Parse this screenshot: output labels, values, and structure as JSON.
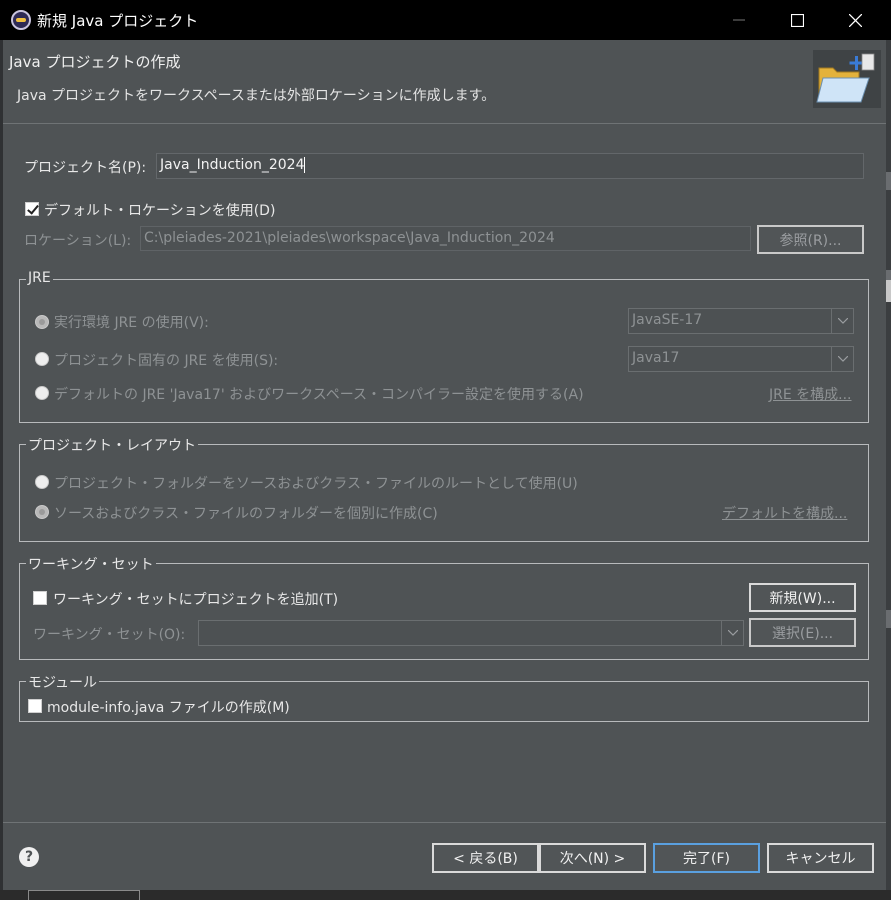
{
  "window": {
    "title": "新規 Java プロジェクト"
  },
  "header": {
    "title": "Java プロジェクトの作成",
    "description": "Java プロジェクトをワークスペースまたは外部ロケーションに作成します。"
  },
  "project": {
    "name_label": "プロジェクト名(P):",
    "name_value": "Java_Induction_2024",
    "use_default_location_label": "デフォルト・ロケーションを使用(D)",
    "use_default_location_checked": true,
    "location_label": "ロケーション(L):",
    "location_value": "C:\\pleiades-2021\\pleiades\\workspace\\Java_Induction_2024",
    "browse_label": "参照(R)..."
  },
  "jre": {
    "group_title": "JRE",
    "option1_label": "実行環境 JRE の使用(V):",
    "option1_value": "JavaSE-17",
    "option2_label": "プロジェクト固有の JRE を使用(S):",
    "option2_value": "Java17",
    "option3_label": "デフォルトの JRE 'Java17' およびワークスペース・コンパイラー設定を使用する(A)",
    "configure_link": "JRE を構成..."
  },
  "layout": {
    "group_title": "プロジェクト・レイアウト",
    "option1_label": "プロジェクト・フォルダーをソースおよびクラス・ファイルのルートとして使用(U)",
    "option2_label": "ソースおよびクラス・ファイルのフォルダーを個別に作成(C)",
    "configure_link": "デフォルトを構成..."
  },
  "working_sets": {
    "group_title": "ワーキング・セット",
    "add_label": "ワーキング・セットにプロジェクトを追加(T)",
    "add_checked": false,
    "new_button": "新規(W)...",
    "sets_label": "ワーキング・セット(O):",
    "select_button": "選択(E)..."
  },
  "module": {
    "group_title": "モジュール",
    "create_label": "module-info.java ファイルの作成(M)",
    "create_checked": false
  },
  "footer": {
    "back_button": "< 戻る(B)",
    "next_button": "次へ(N) >",
    "finish_button": "完了(F)",
    "cancel_button": "キャンセル"
  },
  "colors": {
    "dialog_bg": "#4f5355",
    "titlebar_bg": "#000000",
    "primary_button_border": "#5aa0e0"
  }
}
